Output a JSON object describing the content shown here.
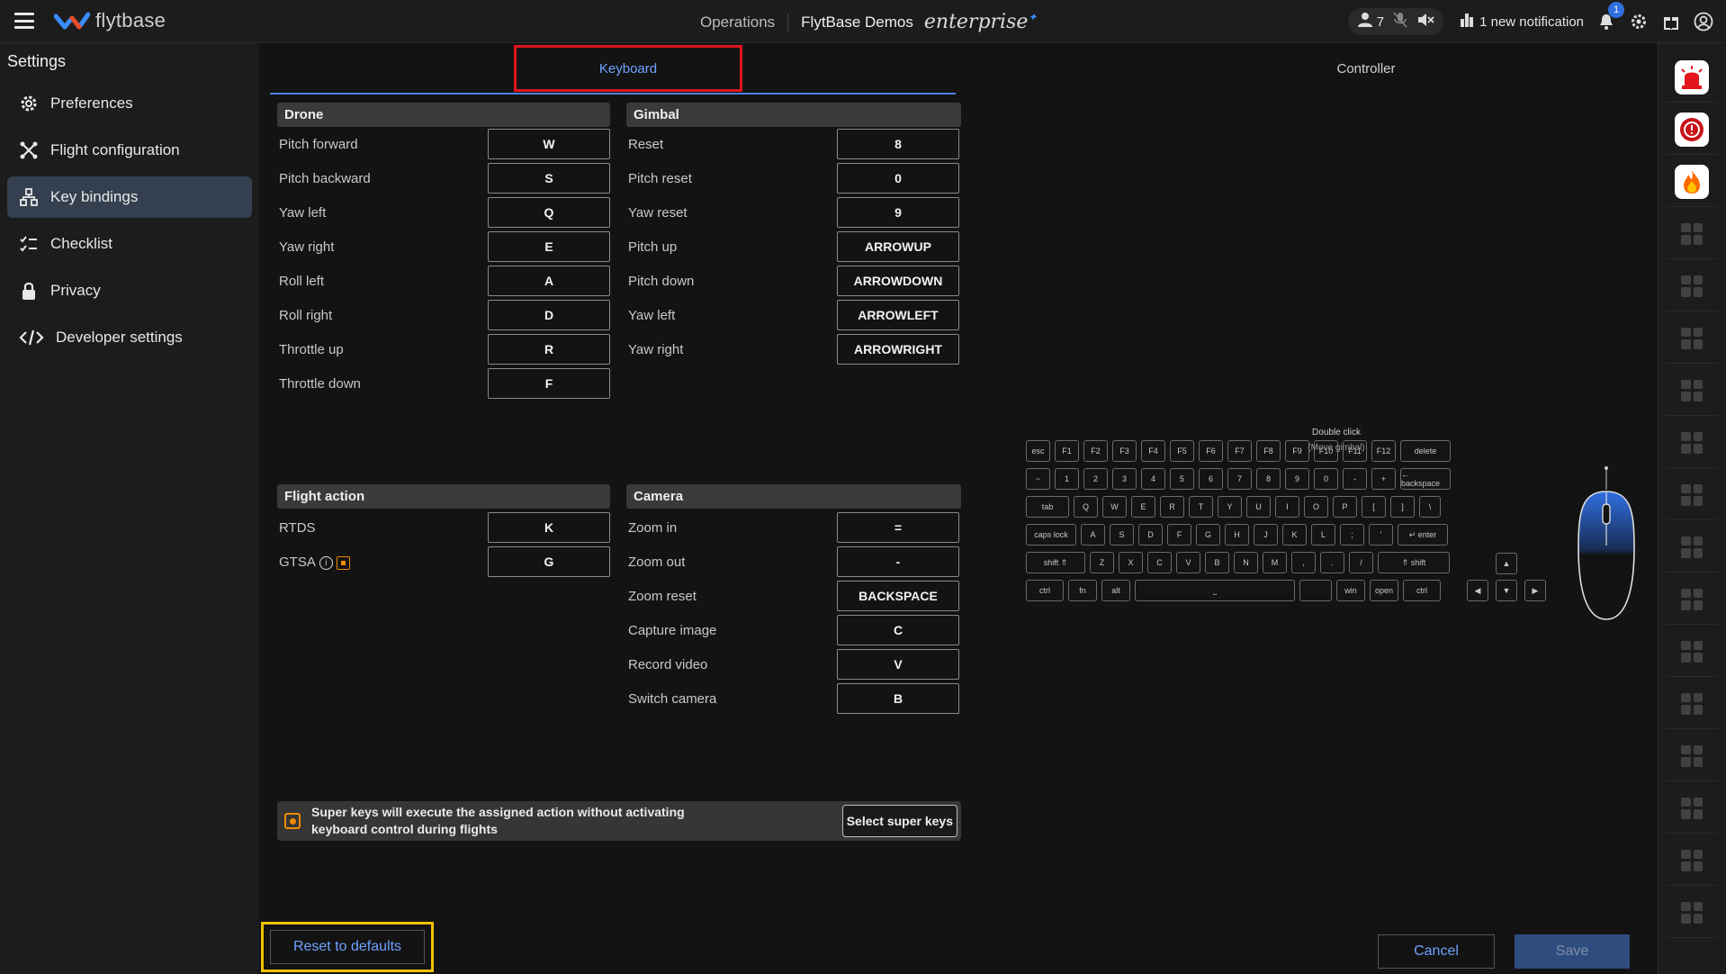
{
  "topbar": {
    "brand": "flytbase",
    "operations": "Operations",
    "org": "FlytBase Demos",
    "edition": "enterprise",
    "users_count": "7",
    "notification_text": "1 new notification",
    "notification_badge": "1"
  },
  "sidebar": {
    "title": "Settings",
    "items": [
      {
        "label": "Preferences",
        "icon": "gear-icon"
      },
      {
        "label": "Flight configuration",
        "icon": "drone-icon"
      },
      {
        "label": "Key bindings",
        "icon": "key-bindings-icon",
        "active": true
      },
      {
        "label": "Checklist",
        "icon": "checklist-icon"
      },
      {
        "label": "Privacy",
        "icon": "lock-icon"
      },
      {
        "label": "Developer settings",
        "icon": "code-icon"
      }
    ]
  },
  "tabs": {
    "keyboard": "Keyboard",
    "controller": "Controller"
  },
  "drone": {
    "title": "Drone",
    "rows": [
      {
        "label": "Pitch forward",
        "key": "W"
      },
      {
        "label": "Pitch backward",
        "key": "S"
      },
      {
        "label": "Yaw left",
        "key": "Q"
      },
      {
        "label": "Yaw right",
        "key": "E"
      },
      {
        "label": "Roll left",
        "key": "A"
      },
      {
        "label": "Roll right",
        "key": "D"
      },
      {
        "label": "Throttle up",
        "key": "R"
      },
      {
        "label": "Throttle down",
        "key": "F"
      }
    ]
  },
  "gimbal": {
    "title": "Gimbal",
    "rows": [
      {
        "label": "Reset",
        "key": "8"
      },
      {
        "label": "Pitch reset",
        "key": "0"
      },
      {
        "label": "Yaw reset",
        "key": "9"
      },
      {
        "label": "Pitch up",
        "key": "ARROWUP"
      },
      {
        "label": "Pitch down",
        "key": "ARROWDOWN"
      },
      {
        "label": "Yaw left",
        "key": "ARROWLEFT"
      },
      {
        "label": "Yaw right",
        "key": "ARROWRIGHT"
      }
    ]
  },
  "flight_action": {
    "title": "Flight action",
    "rows": [
      {
        "label": "RTDS",
        "key": "K"
      },
      {
        "label": "GTSA",
        "key": "G"
      }
    ]
  },
  "camera": {
    "title": "Camera",
    "rows": [
      {
        "label": "Zoom in",
        "key": "="
      },
      {
        "label": "Zoom out",
        "key": "-"
      },
      {
        "label": "Zoom reset",
        "key": "BACKSPACE"
      },
      {
        "label": "Capture image",
        "key": "C"
      },
      {
        "label": "Record video",
        "key": "V"
      },
      {
        "label": "Switch camera",
        "key": "B"
      }
    ]
  },
  "super_keys": {
    "text": "Super keys will execute the assigned action without activating keyboard control during flights",
    "button": "Select super keys"
  },
  "footer": {
    "reset": "Reset to defaults",
    "cancel": "Cancel",
    "save": "Save"
  },
  "keyboard_illustration": {
    "rows": [
      [
        "esc",
        "F1",
        "F2",
        "F3",
        "F4",
        "F5",
        "F6",
        "F7",
        "F8",
        "F9",
        "F10",
        "F11",
        "F12",
        "delete"
      ],
      [
        "~",
        "1",
        "2",
        "3",
        "4",
        "5",
        "6",
        "7",
        "8",
        "9",
        "0",
        "-",
        "+",
        "← backspace"
      ],
      [
        "tab",
        "Q",
        "W",
        "E",
        "R",
        "T",
        "Y",
        "U",
        "I",
        "O",
        "P",
        "[",
        "]",
        "\\"
      ],
      [
        "caps lock",
        "A",
        "S",
        "D",
        "F",
        "G",
        "H",
        "J",
        "K",
        "L",
        ";",
        "'",
        "↵ enter"
      ],
      [
        "shift ⇑",
        "Z",
        "X",
        "C",
        "V",
        "B",
        "N",
        "M",
        ",",
        ".",
        "/",
        "⇑ shift"
      ],
      [
        "ctrl",
        "fn",
        "alt",
        "⎵",
        "",
        "win",
        "open",
        "ctrl"
      ]
    ],
    "mouse_label": "Double click",
    "mouse_sublabel": "(Move gimbal)"
  },
  "rail": {
    "apps": [
      "siren-icon",
      "alert-badge-icon",
      "fire-icon"
    ],
    "placeholder_count": 14
  },
  "colors": {
    "accent": "#4b82e0",
    "highlight_red": "#e0161b",
    "highlight_yellow": "#f2c200",
    "super_orange": "#f08a00"
  }
}
